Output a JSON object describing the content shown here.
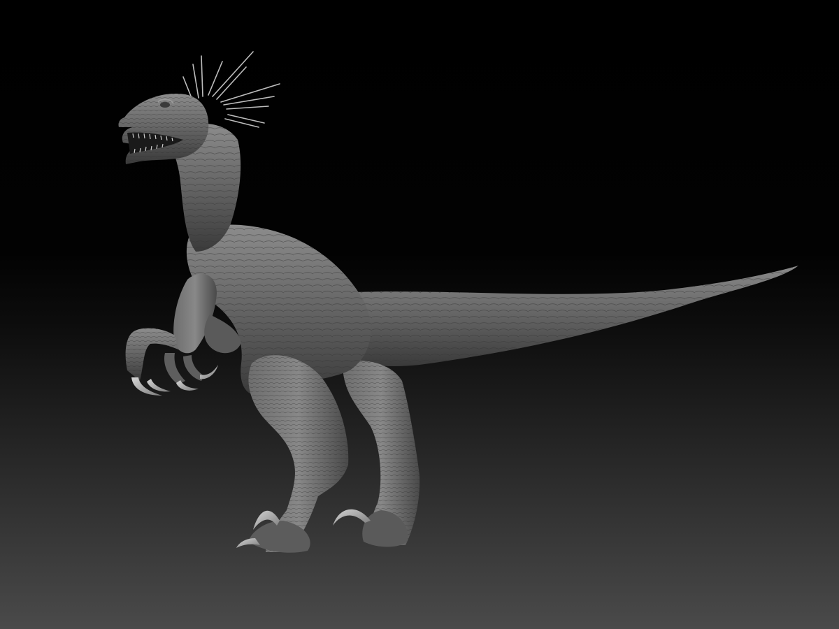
{
  "scene": {
    "subject": "raptor-sculpt",
    "colors": {
      "background_top": "#000000",
      "background_bottom": "#4a4a4a",
      "skin_light": "#8a8a8a",
      "skin_mid": "#5e5e5e",
      "skin_dark": "#2e2e2e",
      "claw": "#b5b5b5"
    }
  }
}
